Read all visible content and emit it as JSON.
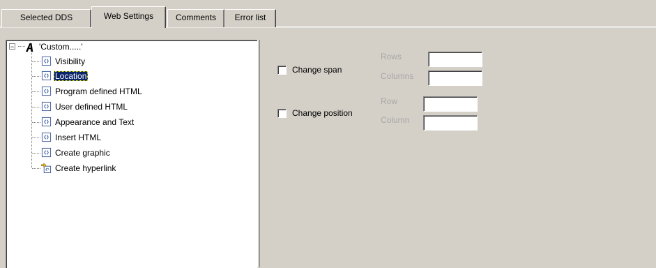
{
  "tabs": [
    {
      "label": "Selected DDS"
    },
    {
      "label": "Web Settings"
    },
    {
      "label": "Comments"
    },
    {
      "label": "Error list"
    }
  ],
  "active_tab": "Web Settings",
  "tree": {
    "root": {
      "label": "'Custom.....'",
      "icon": "bold-a-icon",
      "expander": "minus"
    },
    "items": [
      {
        "label": "Visibility",
        "icon": "web-element-icon"
      },
      {
        "label": "Location",
        "icon": "web-element-icon",
        "selected": true
      },
      {
        "label": "Program defined HTML",
        "icon": "web-element-icon"
      },
      {
        "label": "User defined HTML",
        "icon": "web-element-icon"
      },
      {
        "label": "Appearance and Text",
        "icon": "web-element-icon"
      },
      {
        "label": "Insert HTML",
        "icon": "web-element-icon"
      },
      {
        "label": "Create graphic",
        "icon": "web-element-icon"
      },
      {
        "label": "Create hyperlink",
        "icon": "hyperlink-arrow-icon"
      }
    ]
  },
  "settings": {
    "change_span": {
      "label": "Change span",
      "checked": false
    },
    "rows": {
      "label": "Rows",
      "value": ""
    },
    "columns": {
      "label": "Columns",
      "value": ""
    },
    "change_position": {
      "label": "Change position",
      "checked": false
    },
    "row": {
      "label": "Row",
      "value": ""
    },
    "column": {
      "label": "Column",
      "value": ""
    }
  }
}
